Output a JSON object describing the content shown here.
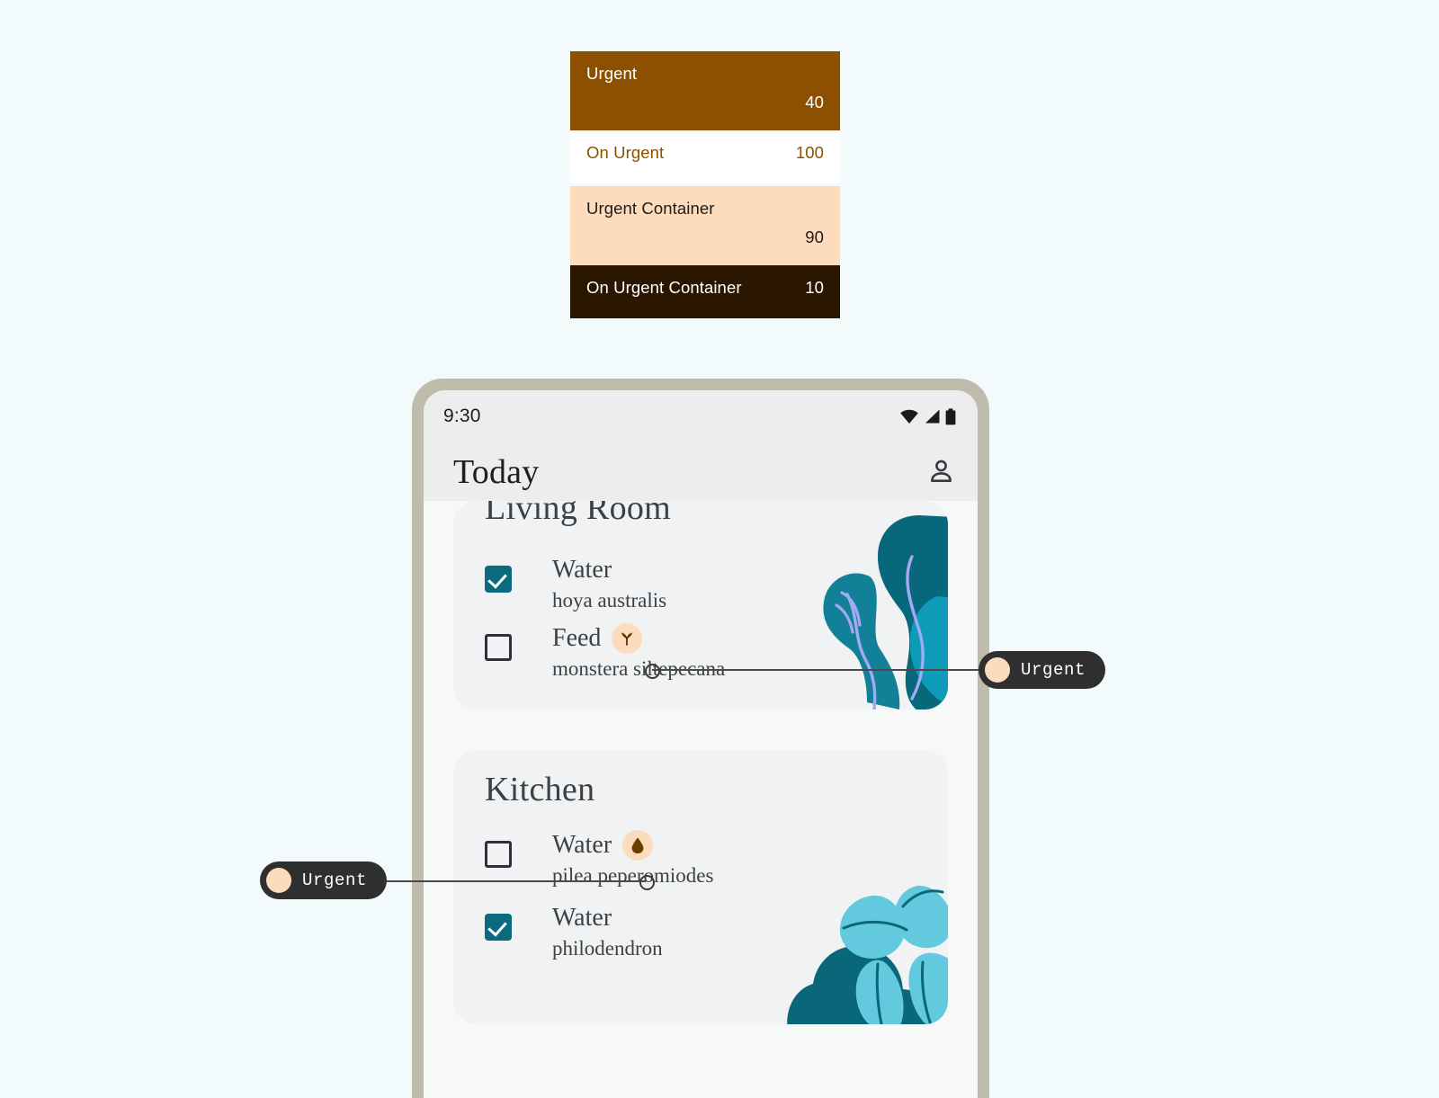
{
  "page": {
    "background_color": "#F2FAFC"
  },
  "swatch_table": {
    "rows": [
      {
        "label": "Urgent",
        "value": "40",
        "bg": "#8C5000",
        "fg": "#FFFFFF",
        "size": "tall"
      },
      {
        "label": "On Urgent",
        "value": "100",
        "bg": "#FFFFFF",
        "fg": "#8C5000",
        "size": "short"
      },
      {
        "label": "Urgent Container",
        "value": "90",
        "bg": "#FDDCBD",
        "fg": "#1F1B16",
        "size": "tall"
      },
      {
        "label": "On Urgent Container",
        "value": "10",
        "bg": "#2B1700",
        "fg": "#FFFFFF",
        "size": "short"
      }
    ]
  },
  "phone": {
    "frame_color": "#BFBCAE",
    "screen_color": "#F7F9F9",
    "status_bar": {
      "time": "9:30",
      "icons": [
        "wifi-icon",
        "cellular-signal-icon",
        "battery-icon"
      ]
    },
    "app_bar": {
      "title": "Today",
      "account_icon": "person-icon"
    },
    "cards": [
      {
        "room": "Living Room",
        "plant_art": "monstera-silhouette",
        "tasks": [
          {
            "checked": true,
            "title": "Water",
            "subtitle": "hoya australis",
            "urgent_badge": null
          },
          {
            "checked": false,
            "title": "Feed",
            "subtitle": "monstera siltepecana",
            "urgent_badge": "sprout-icon"
          }
        ]
      },
      {
        "room": "Kitchen",
        "plant_art": "pilea-silhouette",
        "tasks": [
          {
            "checked": false,
            "title": "Water",
            "subtitle": "pilea peperomiodes",
            "urgent_badge": "water-drop-icon"
          },
          {
            "checked": true,
            "title": "Water",
            "subtitle": "philodendron",
            "urgent_badge": null
          }
        ]
      }
    ]
  },
  "callouts": [
    {
      "label": "Urgent",
      "swatch_color": "#FDDCBD",
      "side": "right"
    },
    {
      "label": "Urgent",
      "swatch_color": "#FDDCBD",
      "side": "left"
    }
  ],
  "colors": {
    "urgent": "#8C5000",
    "on_urgent": "#FFFFFF",
    "urgent_container": "#FDDCBD",
    "on_urgent_container": "#2B1700",
    "checkbox_checked": "#0C6A7E",
    "callout_bg": "#2F2F2F",
    "card_bg": "#F1F2F3",
    "plant_dark_teal": "#0C6A7E",
    "plant_mid_teal": "#128197",
    "plant_light_blue": "#62C9DF",
    "plant_vein": "#A3A9F5"
  }
}
